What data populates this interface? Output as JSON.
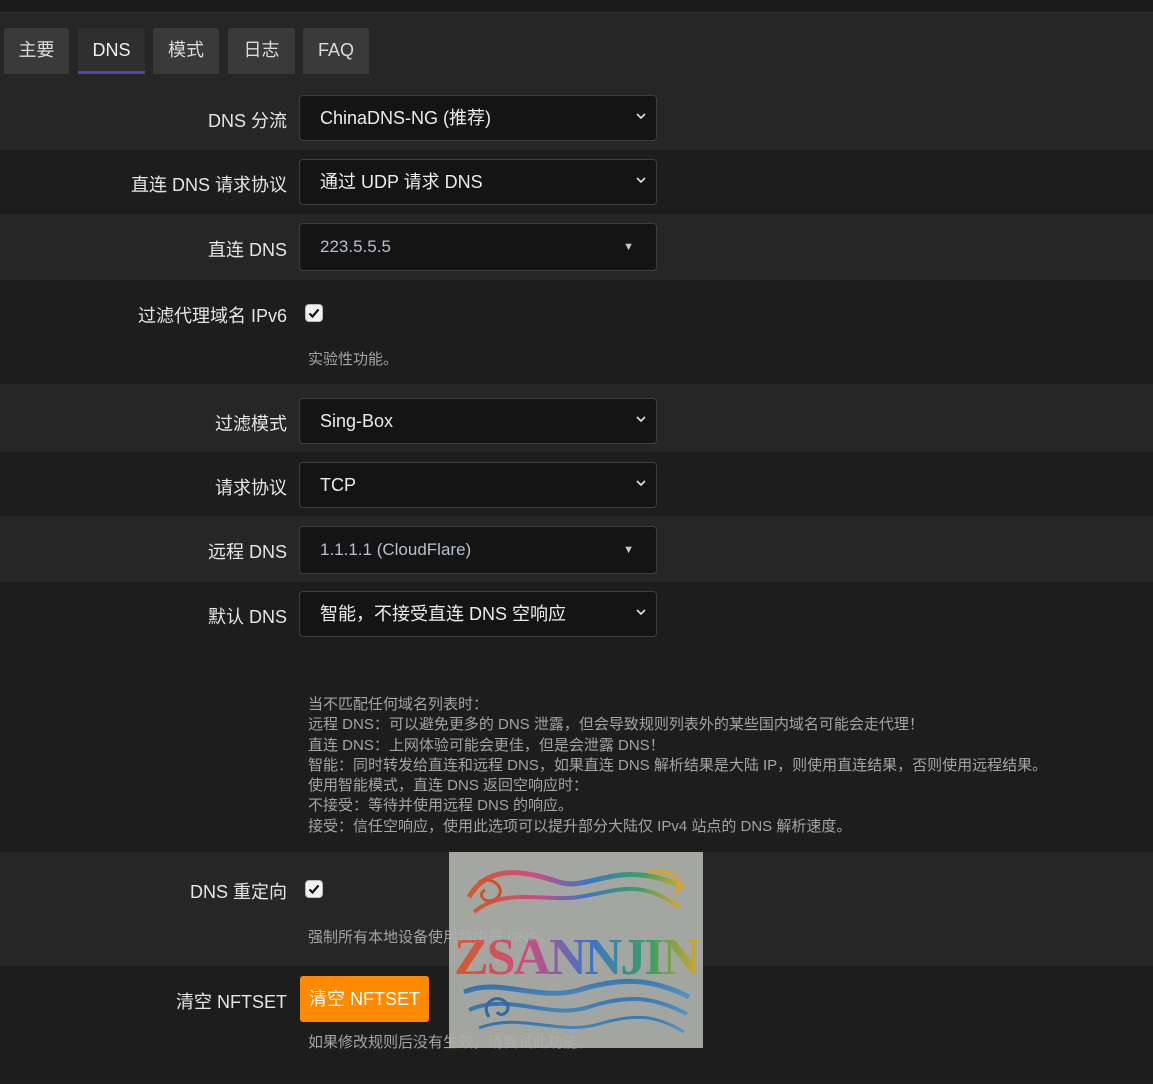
{
  "tabs": [
    "主要",
    "DNS",
    "模式",
    "日志",
    "FAQ"
  ],
  "active_tab": "DNS",
  "dns_split": {
    "label": "DNS 分流",
    "value": "ChinaDNS-NG (推荐)"
  },
  "direct_protocol": {
    "label": "直连 DNS 请求协议",
    "value": "通过 UDP 请求 DNS"
  },
  "direct_dns": {
    "label": "直连 DNS",
    "value": "223.5.5.5"
  },
  "filter_ipv6": {
    "label": "过滤代理域名 IPv6",
    "checked": true,
    "desc": "实验性功能。"
  },
  "filter_mode": {
    "label": "过滤模式",
    "value": "Sing-Box"
  },
  "request_protocol": {
    "label": "请求协议",
    "value": "TCP"
  },
  "remote_dns": {
    "label": "远程 DNS",
    "value": "1.1.1.1 (CloudFlare)"
  },
  "default_dns": {
    "label": "默认 DNS",
    "value": "智能，不接受直连 DNS 空响应",
    "desc": "当不匹配任何域名列表时：\n远程 DNS：可以避免更多的 DNS 泄露，但会导致规则列表外的某些国内域名可能会走代理！\n直连 DNS：上网体验可能会更佳，但是会泄露 DNS！\n智能：同时转发给直连和远程 DNS，如果直连 DNS 解析结果是大陆 IP，则使用直连结果，否则使用远程结果。\n使用智能模式，直连 DNS 返回空响应时：\n不接受：等待并使用远程 DNS 的响应。\n接受：信任空响应，使用此选项可以提升部分大陆仅 IPv4 站点的 DNS 解析速度。"
  },
  "dns_redirect": {
    "label": "DNS 重定向",
    "checked": true,
    "desc": "强制所有本地设备使用路由器 DNS。"
  },
  "clear_nftset": {
    "label": "清空 NFTSET",
    "button": "清空 NFTSET",
    "desc": "如果修改规则后没有生效，请尝试此功能。"
  },
  "watermark": {
    "text": "ZSANNJIN"
  },
  "colors": {
    "accent": "#5b3fa8",
    "button": "#ff8a00"
  }
}
